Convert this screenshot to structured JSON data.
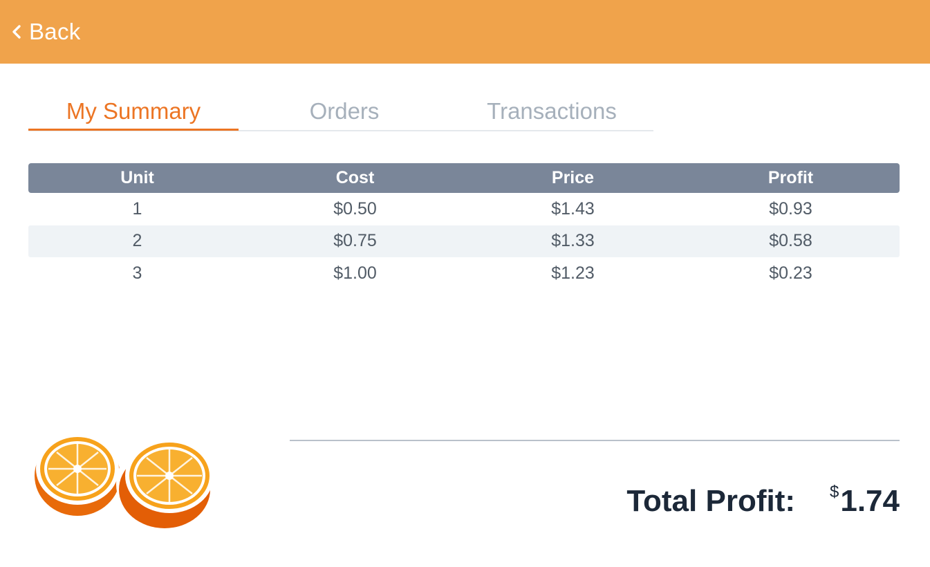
{
  "header": {
    "back_label": "Back",
    "back_icon": "chevron-left-icon",
    "background_color": "#f0a34b"
  },
  "tabs": [
    {
      "label": "My Summary",
      "active": true
    },
    {
      "label": "Orders",
      "active": false
    },
    {
      "label": "Transactions",
      "active": false
    }
  ],
  "accent_color": "#ec7524",
  "table": {
    "columns": [
      "Unit",
      "Cost",
      "Price",
      "Profit"
    ],
    "rows": [
      [
        "1",
        "$0.50",
        "$1.43",
        "$0.93"
      ],
      [
        "2",
        "$0.75",
        "$1.33",
        "$0.58"
      ],
      [
        "3",
        "$1.00",
        "$1.23",
        "$0.23"
      ]
    ]
  },
  "summary": {
    "total_label": "Total Profit:",
    "currency_symbol": "$",
    "total_value": "1.74"
  },
  "illustration": "orange-halves"
}
